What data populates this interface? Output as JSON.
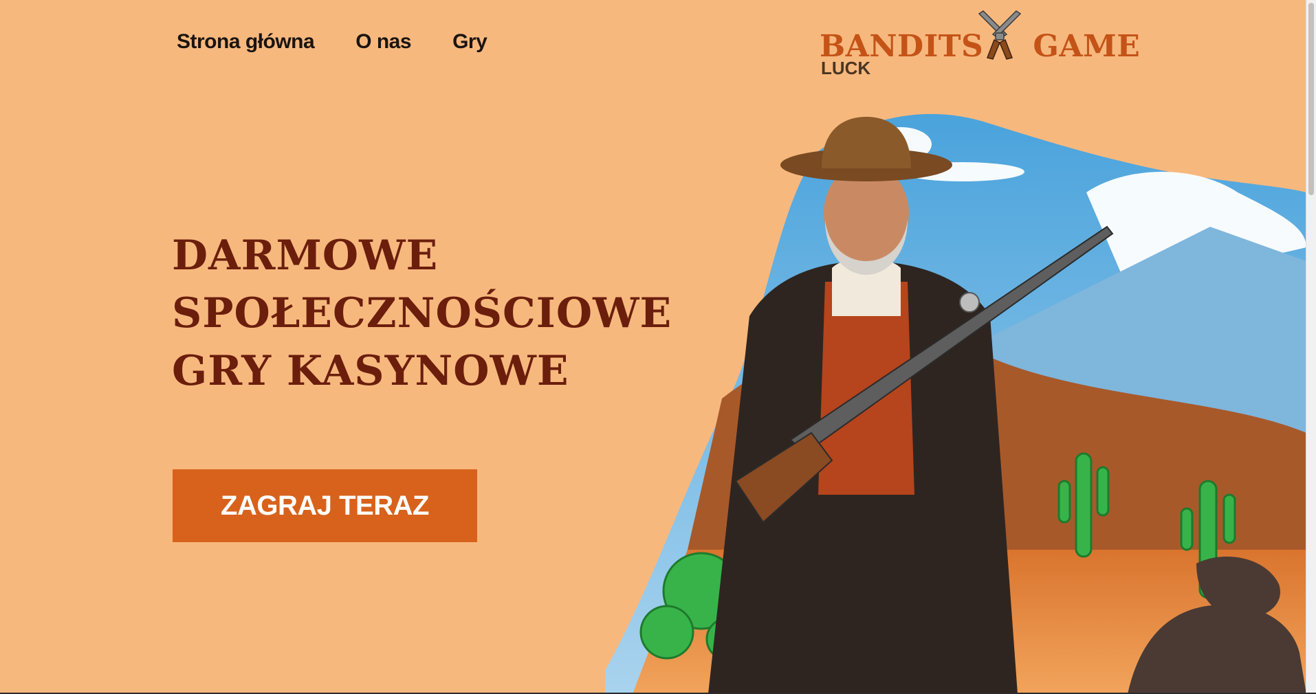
{
  "nav": {
    "items": [
      {
        "label": "Strona główna"
      },
      {
        "label": "O nas"
      },
      {
        "label": "Gry"
      }
    ]
  },
  "logo": {
    "main_left": "BANDITS",
    "main_right": "GAME",
    "sub": "LUCK",
    "icon": "crossed-revolvers-icon"
  },
  "hero": {
    "title_lines": [
      "DARMOWE",
      "SPOŁECZNOŚCIOWE",
      "GRY KASYNOWE"
    ],
    "cta_label": "ZAGRAJ TERAZ"
  },
  "colors": {
    "background": "#f7b87e",
    "title": "#6b1e0c",
    "accent": "#d8621b",
    "logo": "#c45317"
  }
}
